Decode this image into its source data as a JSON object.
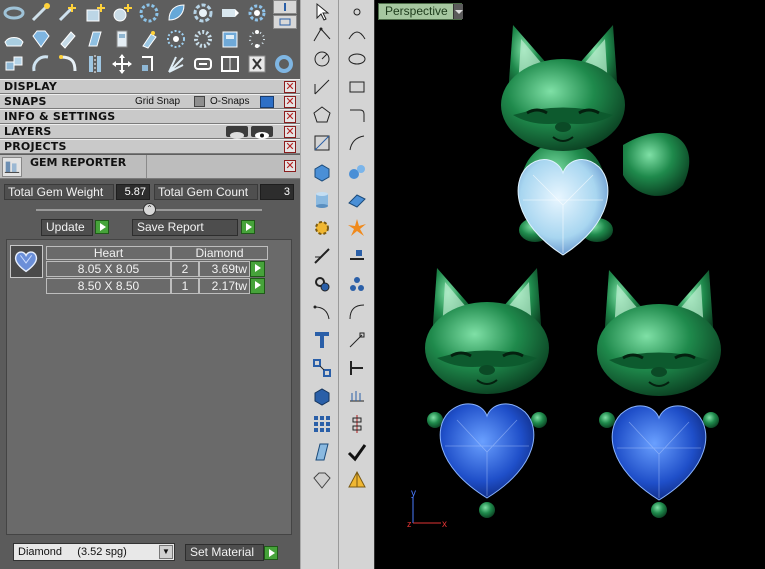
{
  "panels": {
    "display": "DISPLAY",
    "snaps": "SNAPS",
    "grid_snap": "Grid Snap",
    "o_snaps": "O-Snaps",
    "info": "INFO & SETTINGS",
    "layers": "LAYERS",
    "projects": "PROJECTS",
    "close_glyph": "✕"
  },
  "gem_reporter": {
    "title": "GEM REPORTER",
    "total_weight_label": "Total Gem Weight",
    "total_weight_value": "5.87",
    "total_count_label": "Total Gem Count",
    "total_count_value": "3",
    "update_label": "Update",
    "save_report_label": "Save Report",
    "table": {
      "headers": [
        "Heart",
        "Diamond"
      ],
      "rows": [
        {
          "size": "8.05 X 8.05",
          "count": "2",
          "weight": "3.69tw"
        },
        {
          "size": "8.50 X 8.50",
          "count": "1",
          "weight": "2.17tw"
        }
      ]
    },
    "material_select": "Diamond     (3.52 spg)",
    "set_material_label": "Set Material"
  },
  "viewport": {
    "view_label": "Perspective",
    "axis_y": "y",
    "axis_z": "z",
    "axis_x": "x"
  },
  "colors": {
    "model_green": "#1f8a4c",
    "heart_light": "#a8d6f0",
    "heart_blue": "#1f4fc9",
    "play_green": "#46a33a",
    "close_red": "#b51c1c"
  },
  "icons": {
    "toolbar": [
      "ring-icon",
      "wand-icon",
      "add-pen-icon",
      "add-grid-icon",
      "add-stone-icon",
      "gear-ring-icon",
      "leaf-icon",
      "flower-icon",
      "pen-tool-icon",
      "cog-icon",
      "surface-icon",
      "diamond-icon",
      "sweep-icon",
      "cutter-icon",
      "door-icon",
      "bend-icon",
      "star-flower-icon",
      "dots-ring-icon",
      "flask-icon",
      "bead-ring-icon",
      "cubes-icon",
      "arc-icon",
      "curve-icon",
      "mirror-icon",
      "move-icon",
      "scale-icon",
      "burst-icon",
      "link-icon",
      "chain-icon",
      "scissors-icon",
      "torus-icon"
    ]
  }
}
